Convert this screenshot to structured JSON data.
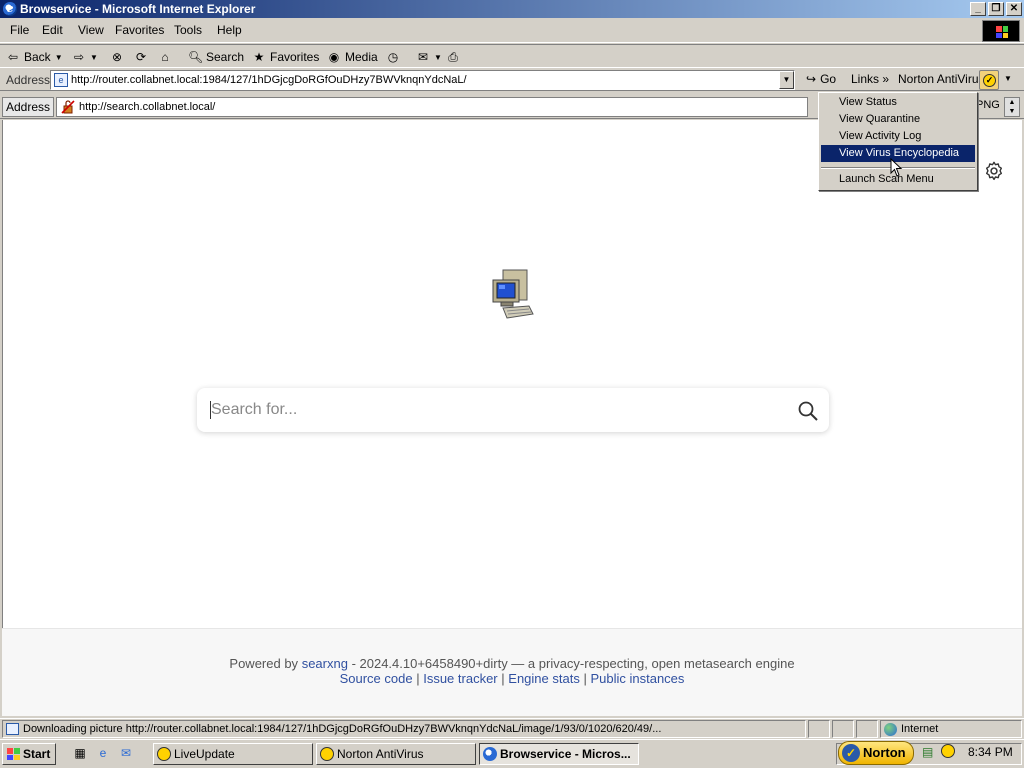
{
  "window": {
    "title": "Browservice - Microsoft Internet Explorer",
    "controls": {
      "minimize": "_",
      "maximize": "❐",
      "close": "✕"
    }
  },
  "menubar": {
    "items": [
      "File",
      "Edit",
      "View",
      "Favorites",
      "Tools",
      "Help"
    ]
  },
  "toolbar": {
    "back": "Back",
    "search": "Search",
    "favorites": "Favorites",
    "media": "Media"
  },
  "address": {
    "label": "Address",
    "url": "http://router.collabnet.local:1984/127/1hDGjcgDoRGfOuDHzy7BWVknqnYdcNaL/",
    "go": "Go",
    "links": "Links",
    "links_more": "»",
    "norton": "Norton AntiVirus"
  },
  "inner_address": {
    "label": "Address",
    "url": "http://search.collabnet.local/",
    "right_text": "PNG"
  },
  "norton_menu": {
    "items": [
      {
        "label": "View Status"
      },
      {
        "label": "View Quarantine"
      },
      {
        "label": "View Activity Log"
      },
      {
        "label": "View Virus Encyclopedia",
        "selected": true
      },
      {
        "label": "Launch Scan Menu"
      }
    ]
  },
  "page": {
    "search_placeholder": "Search for...",
    "footer": {
      "powered_by": "Powered by",
      "engine": "searxng",
      "version_text": "- 2024.4.10+6458490+dirty — a privacy-respecting, open metasearch engine",
      "links": [
        "Source code",
        "Issue tracker",
        "Engine stats",
        "Public instances"
      ],
      "separator": "|"
    }
  },
  "statusbar": {
    "message": "Downloading picture http://router.collabnet.local:1984/127/1hDGjcgDoRGfOuDHzy7BWVknqnYdcNaL/image/1/93/0/1020/620/49/...",
    "zone": "Internet"
  },
  "taskbar": {
    "start": "Start",
    "tasks": [
      {
        "label": "LiveUpdate",
        "active": false
      },
      {
        "label": "Norton AntiVirus",
        "active": false
      },
      {
        "label": "Browservice - Micros...",
        "active": true
      }
    ],
    "norton_button": "Norton",
    "clock": "8:34 PM"
  },
  "colors": {
    "titlebar": "#0a246a",
    "selection": "#0a246a",
    "link": "#3050a0",
    "norton_yellow": "#ffd200"
  }
}
